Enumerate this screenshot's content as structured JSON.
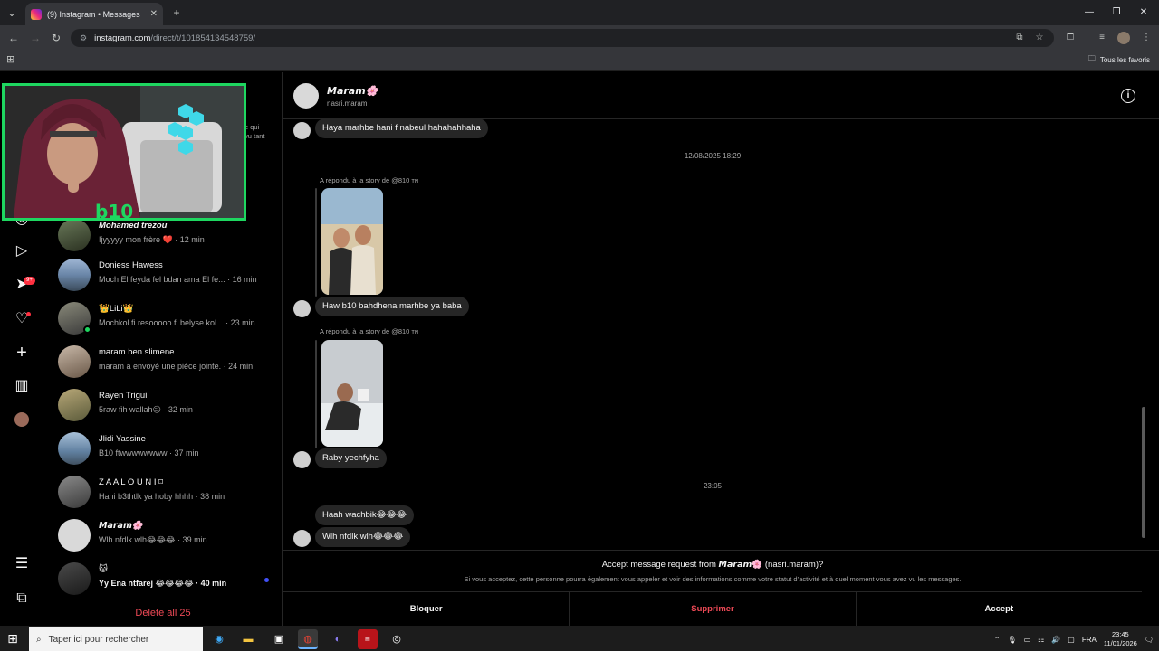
{
  "browser": {
    "tab_title": "(9) Instagram • Messages",
    "url_host": "instagram.com",
    "url_path": "/direct/t/101854134548759/",
    "bookmarks_label": "Tous les favoris"
  },
  "sidebar": {
    "notifications_badge": "9+",
    "delete_all": "Delete all 25",
    "partial_text_1": "e qui",
    "partial_text_2": "vu tant"
  },
  "conversations": [
    {
      "name": "Mohamed trezou",
      "preview": "Ijyyyyy mon frère ❤️ · 12 min",
      "unread": false
    },
    {
      "name": "Doniess Hawess",
      "preview": "Moch El feyda fel bdan ama El fe... · 16 min",
      "unread": false
    },
    {
      "name": "👑LiLi👑",
      "preview": "Mochkol fi resooooo fi belyse kol... · 23 min",
      "unread": false
    },
    {
      "name": "maram ben slimene",
      "preview": "maram a envoyé une pièce jointe. · 24 min",
      "unread": false
    },
    {
      "name": "Rayen Trigui",
      "preview": "5raw fih wallah😉 · 32 min",
      "unread": false
    },
    {
      "name": "Jlidi Yassine",
      "preview": "B10 ftwwwwwwww · 37 min",
      "unread": false
    },
    {
      "name": "Z A A L O U N I ⌑",
      "preview": "Hani b3thtlk ya hoby hhhh · 38 min",
      "unread": false
    },
    {
      "name": "𝙈𝙖𝙧𝙖𝙢🌸",
      "preview": "Wlh nfdlk wlh😂😂😂 · 39 min",
      "unread": false
    },
    {
      "name": "🐱",
      "preview": "Yy Ena ntfarej 😂😂😂😂 · 40 min",
      "unread": true
    }
  ],
  "chat": {
    "name": "𝙈𝙖𝙧𝙖𝙢🌸",
    "handle": "nasri.maram",
    "messages": {
      "m1": "Haya marhbe hani f nabeul hahahahhaha",
      "stamp1": "12/08/2025 18:29",
      "reply1_label": "A répondu à la story de @810 ᴛɴ",
      "m2": "Haw b10 bahdhena marhbe ya baba",
      "reply2_label": "A répondu à la story de @810 ᴛɴ",
      "m3": "Raby yechfyha",
      "stamp2": "23:05",
      "m4": "Haah wachbik😂😂😂",
      "m5": "Wlh nfdlk wlh😂😂😂"
    },
    "request": {
      "title": "Accept message request from 𝙈𝙖𝙧𝙖𝙢🌸 (nasri.maram)?",
      "description": "Si vous acceptez, cette personne pourra également vous appeler et voir des informations comme votre statut d’activité et à quel moment vous avez vu les messages.",
      "block": "Bloquer",
      "delete": "Supprimer",
      "accept": "Accept"
    }
  },
  "taskbar": {
    "search_placeholder": "Taper ici pour rechercher",
    "language": "FRA",
    "time": "23:45",
    "date": "11/01/2026"
  },
  "colors": {
    "accent_red": "#ed4956",
    "webcam_border": "#1ed760",
    "unread_dot": "#4150f7"
  }
}
